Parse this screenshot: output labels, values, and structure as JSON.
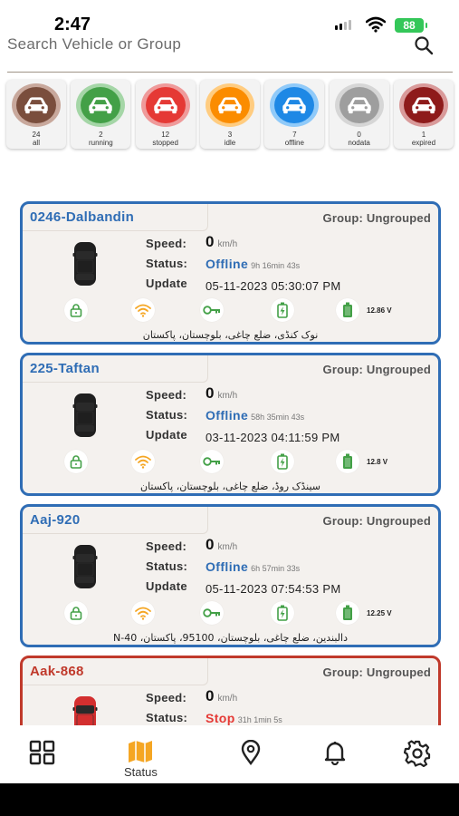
{
  "status_bar": {
    "time": "2:47",
    "battery": "88"
  },
  "search": {
    "placeholder": "Search Vehicle or Group"
  },
  "filters": [
    {
      "count": "24",
      "label": "all",
      "color": "#7a4e3d",
      "ring": "#c8a89c"
    },
    {
      "count": "2",
      "label": "running",
      "color": "#43a047",
      "ring": "#a5d6a7"
    },
    {
      "count": "12",
      "label": "stopped",
      "color": "#e53935",
      "ring": "#ef9a9a"
    },
    {
      "count": "3",
      "label": "idle",
      "color": "#fb8c00",
      "ring": "#ffcc80"
    },
    {
      "count": "7",
      "label": "offline",
      "color": "#1e88e5",
      "ring": "#90caf9"
    },
    {
      "count": "0",
      "label": "nodata",
      "color": "#9e9e9e",
      "ring": "#d6d6d6"
    },
    {
      "count": "1",
      "label": "expired",
      "color": "#8e1b1b",
      "ring": "#d99a9a"
    }
  ],
  "labels": {
    "speed": "Speed:",
    "status": "Status:",
    "update": "Update",
    "unit": "km/h"
  },
  "vehicles": [
    {
      "name": "0246-Dalbandin",
      "group": "Group: Ungrouped",
      "speed": "0",
      "status": "Offline",
      "duration": "9h 16min 43s",
      "update": "05-11-2023 05:30:07 PM",
      "voltage": "12.86 V",
      "address": "نوک کنڈی، ضلع چاغی، بلوچستان، پاکستان"
    },
    {
      "name": "225-Taftan",
      "group": "Group: Ungrouped",
      "speed": "0",
      "status": "Offline",
      "duration": "58h 35min 43s",
      "update": "03-11-2023 04:11:59 PM",
      "voltage": "12.8 V",
      "address": "سینڈک روڈ، ضلع چاغی، بلوچستان، پاکستان"
    },
    {
      "name": "Aaj-920",
      "group": "Group: Ungrouped",
      "speed": "0",
      "status": "Offline",
      "duration": "6h 57min 33s",
      "update": "05-11-2023 07:54:53 PM",
      "voltage": "12.25 V",
      "address": "دالبندین، ضلع چاغی، بلوچستان، 95100، پاکستان، N-40"
    },
    {
      "name": "Aak-868",
      "group": "Group: Ungrouped",
      "speed": "0",
      "status": "Stop",
      "duration": "31h 1min 5s"
    }
  ],
  "nav": {
    "status_label": "Status"
  },
  "colors": {
    "offline_blue": "#2f6db5",
    "stop_red": "#c0392b",
    "icon_green": "#43a047",
    "icon_orange": "#f5a623"
  }
}
